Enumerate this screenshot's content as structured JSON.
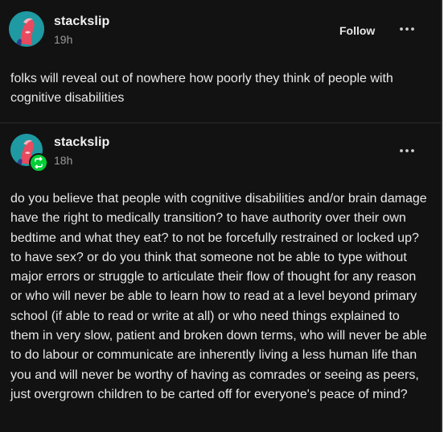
{
  "post": {
    "author": "stackslip",
    "time": "19h",
    "follow_label": "Follow",
    "more_icon": "more-horizontal-icon",
    "text": "folks will reveal out of nowhere how poorly they think of people with cognitive disabilities"
  },
  "reblog": {
    "author": "stackslip",
    "time": "18h",
    "badge_icon": "reblog-icon",
    "badge_color": "#00cf35",
    "more_icon": "more-horizontal-icon",
    "text": "do you believe that people with cognitive disabilities and/or brain damage have the right to medically transition? to have authority over their own bedtime and what they eat? to not be forcefully restrained or locked up? to have sex? or do you think that someone not be able to type without major errors or struggle to articulate their flow of thought for any reason or who will never be able to learn how to read at a level beyond primary school (if able to read or write at all) or who need things explained to them in very slow, patient and broken down terms, who will never be able to do labour or communicate are inherently living a less human life than you and will never be worthy of having as comrades or seeing as peers, just overgrown children to be carted off for everyone's peace of mind?"
  },
  "colors": {
    "background": "#121212",
    "text": "#e8e8e8",
    "muted": "#9a9a9a",
    "avatar_bg": "#1e8f9a"
  }
}
